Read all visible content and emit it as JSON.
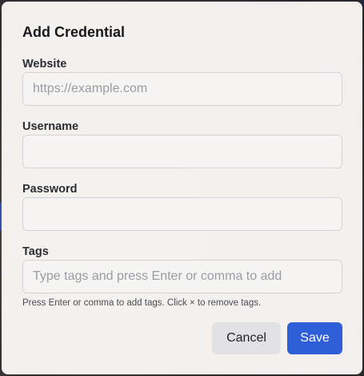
{
  "dialog": {
    "title": "Add Credential",
    "website": {
      "label": "Website",
      "value": "",
      "placeholder": "https://example.com"
    },
    "username": {
      "label": "Username",
      "value": "",
      "placeholder": ""
    },
    "password": {
      "label": "Password",
      "value": "",
      "placeholder": ""
    },
    "tags": {
      "label": "Tags",
      "value": "",
      "placeholder": "Type tags and press Enter or comma to add",
      "hint": "Press Enter or comma to add tags. Click × to remove tags."
    },
    "buttons": {
      "cancel": "Cancel",
      "save": "Save"
    }
  },
  "colors": {
    "primary": "#2f5fd8",
    "secondary_button": "#e2e2e5",
    "dialog_background": "#faf7f5"
  }
}
